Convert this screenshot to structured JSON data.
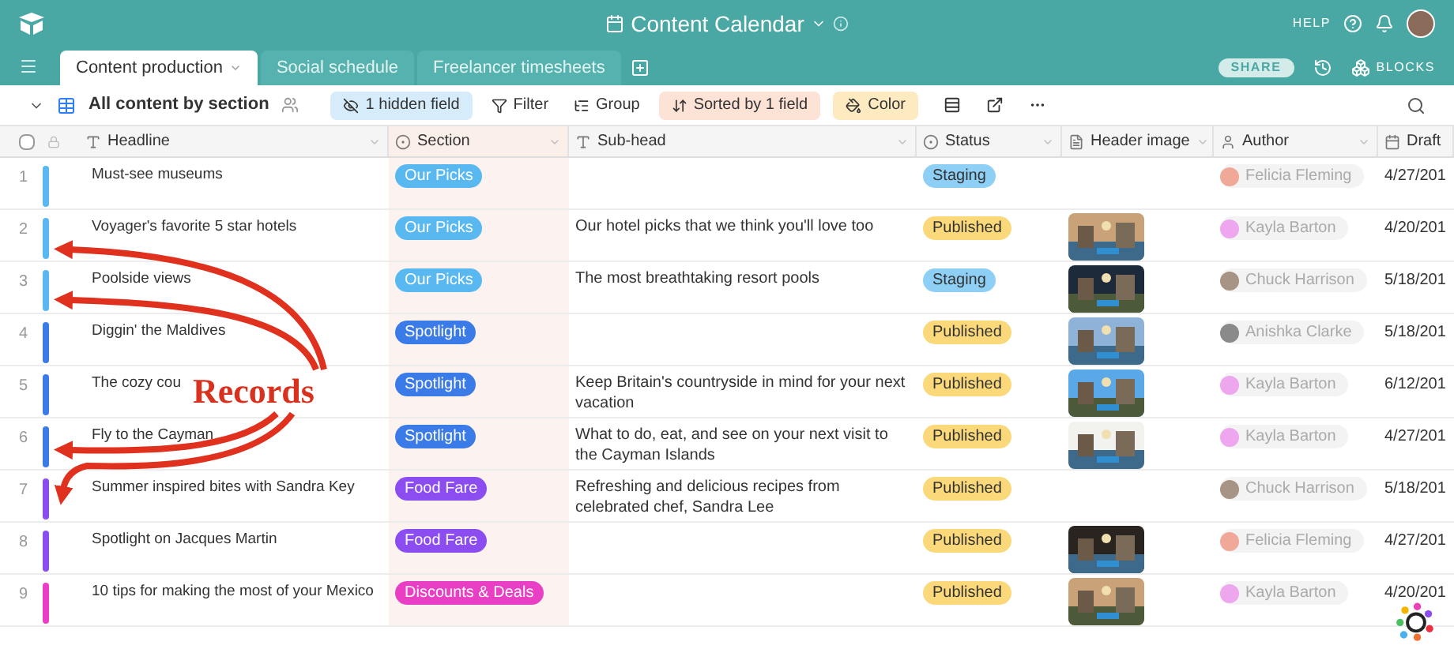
{
  "app_bar": {
    "title": "Content Calendar",
    "help": "HELP"
  },
  "tabs": [
    {
      "label": "Content production",
      "selected": true
    },
    {
      "label": "Social schedule",
      "selected": false
    },
    {
      "label": "Freelancer timesheets",
      "selected": false
    }
  ],
  "tab_bar_actions": {
    "share": "SHARE",
    "blocks": "BLOCKS"
  },
  "toolbar": {
    "view": "All content by section",
    "hidden_fields": "1 hidden field",
    "filter": "Filter",
    "group": "Group",
    "sort": "Sorted by 1 field",
    "color_button": "Color"
  },
  "table": {
    "select_all": {
      "checked": false
    },
    "columns": [
      "Headline",
      "Section",
      "Sub-head",
      "Status",
      "Header image",
      "Author",
      "Draft"
    ],
    "rows": [
      {
        "number": "1",
        "color": "#5ab8f0",
        "headline": "Must-see museums",
        "section": {
          "label": "Our Picks",
          "color": "#5ab8f0"
        },
        "status": {
          "label": "Staging",
          "color": "#8ecff5"
        },
        "image": false,
        "author": {
          "name": "Felicia Fleming",
          "color": "#f0a898"
        },
        "draft": "4/27/201"
      },
      {
        "number": "2",
        "color": "#5ab8f0",
        "headline": "Voyager's favorite 5 star hotels",
        "section": {
          "label": "Our Picks",
          "color": "#5ab8f0"
        },
        "subhead": "Our hotel picks that we think you'll love too",
        "status": {
          "label": "Published",
          "color": "#fbd97a"
        },
        "image": true,
        "author": {
          "name": "Kayla Barton",
          "color": "#eea6ee"
        },
        "draft": "4/20/201"
      },
      {
        "number": "3",
        "color": "#5ab8f0",
        "headline": "Poolside views",
        "section": {
          "label": "Our Picks",
          "color": "#5ab8f0"
        },
        "subhead": "The most breathtaking resort pools",
        "status": {
          "label": "Staging",
          "color": "#8ecff5"
        },
        "image": true,
        "author": {
          "name": "Chuck Harrison",
          "color": "#a89484"
        },
        "draft": "5/18/201"
      },
      {
        "number": "4",
        "color": "#3b7be8",
        "headline": "Diggin' the Maldives",
        "section": {
          "label": "Spotlight",
          "color": "#3b7be8"
        },
        "status": {
          "label": "Published",
          "color": "#fbd97a"
        },
        "image": true,
        "author": {
          "name": "Anishka Clarke",
          "color": "#8a8a8a"
        },
        "draft": "5/18/201"
      },
      {
        "number": "5",
        "color": "#3b7be8",
        "headline": "The cozy cou",
        "section": {
          "label": "Spotlight",
          "color": "#3b7be8"
        },
        "subhead": "Keep Britain's countryside in mind for your next vacation",
        "status": {
          "label": "Published",
          "color": "#fbd97a"
        },
        "image": true,
        "author": {
          "name": "Kayla Barton",
          "color": "#eea6ee"
        },
        "draft": "6/12/201"
      },
      {
        "number": "6",
        "color": "#3b7be8",
        "headline": "Fly to the Cayman",
        "section": {
          "label": "Spotlight",
          "color": "#3b7be8"
        },
        "subhead": "What to do, eat, and see on your next visit to the Cayman Islands",
        "status": {
          "label": "Published",
          "color": "#fbd97a"
        },
        "image": true,
        "author": {
          "name": "Kayla Barton",
          "color": "#eea6ee"
        },
        "draft": "4/27/201"
      },
      {
        "number": "7",
        "color": "#8b4cf0",
        "headline": "Summer inspired bites with Sandra Key",
        "section": {
          "label": "Food Fare",
          "color": "#8b4cf0"
        },
        "subhead": "Refreshing and delicious recipes from celebrated chef, Sandra Lee",
        "status": {
          "label": "Published",
          "color": "#fbd97a"
        },
        "image": false,
        "author": {
          "name": "Chuck Harrison",
          "color": "#a89484"
        },
        "draft": "5/18/201"
      },
      {
        "number": "8",
        "color": "#8b4cf0",
        "headline": "Spotlight on Jacques Martin",
        "section": {
          "label": "Food Fare",
          "color": "#8b4cf0"
        },
        "status": {
          "label": "Published",
          "color": "#fbd97a"
        },
        "image": true,
        "author": {
          "name": "Felicia Fleming",
          "color": "#f0a898"
        },
        "draft": "4/27/201"
      },
      {
        "number": "9",
        "color": "#e83fc4",
        "headline": "10 tips for making the most of your Mexico",
        "section": {
          "label": "Discounts & Deals",
          "color": "#e83fc4"
        },
        "status": {
          "label": "Published",
          "color": "#fbd97a"
        },
        "image": true,
        "author": {
          "name": "Kayla Barton",
          "color": "#eea6ee"
        },
        "draft": "4/20/201"
      }
    ]
  },
  "annotation": {
    "label": "Records"
  }
}
